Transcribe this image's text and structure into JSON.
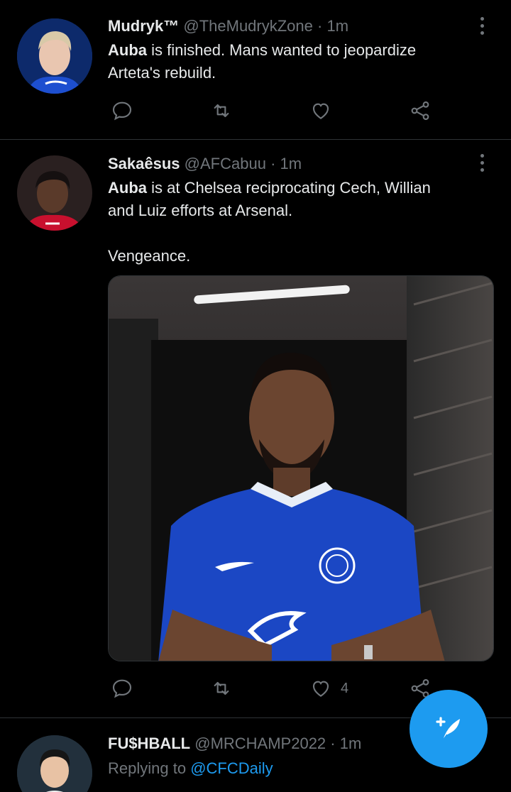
{
  "tweets": [
    {
      "name": "Mudryk™",
      "handle": "@TheMudrykZone",
      "separator": "·",
      "time": "1m",
      "bold_lead": "Auba",
      "text": " is finished. Mans wanted to jeopardize\nArteta's rebuild.",
      "likes": ""
    },
    {
      "name": "Sakaêsus",
      "handle": "@AFCabuu",
      "separator": "·",
      "time": "1m",
      "bold_lead": "Auba",
      "text": " is at Chelsea reciprocating Cech, Willian\nand Luiz efforts at Arsenal.\n\nVengeance.",
      "likes": "4"
    },
    {
      "name": "FU$HBALL",
      "handle": "@MRCHAMP2022",
      "separator": "·",
      "time": "1m",
      "replying_label": "Replying to",
      "replying_handle": "@CFCDaily"
    }
  ],
  "colors": {
    "background": "#000000",
    "accent": "#1d9bf0",
    "secondary_text": "#71767b",
    "divider": "#2f3336",
    "chelsea_blue": "#1b47c4"
  },
  "icons": [
    "reply-icon",
    "retweet-icon",
    "like-icon",
    "share-icon",
    "more-icon",
    "compose-tweet-icon"
  ]
}
